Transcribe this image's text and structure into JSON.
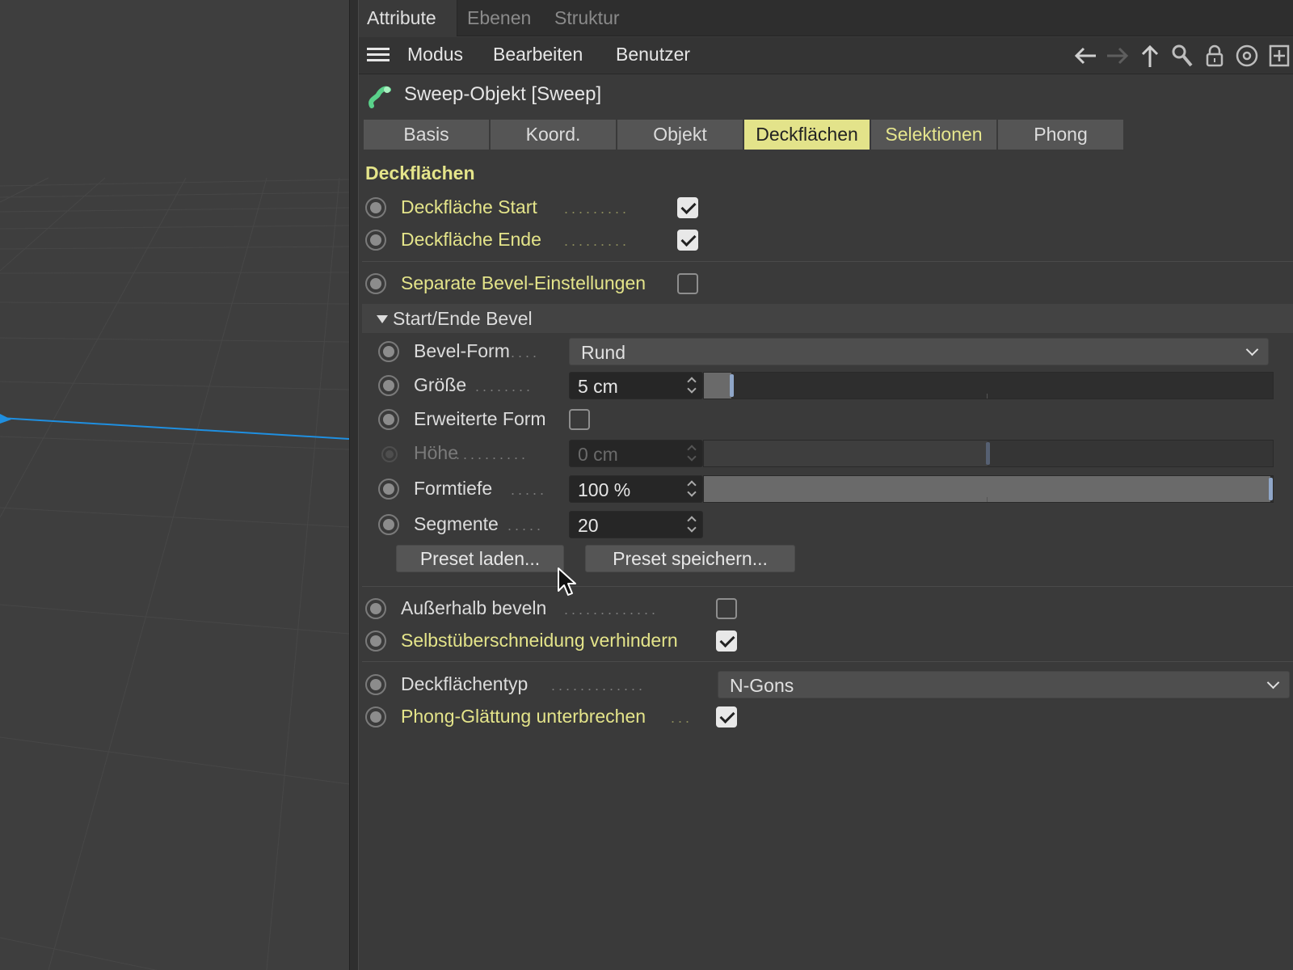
{
  "top_tabs": [
    "Attribute",
    "Ebenen",
    "Struktur"
  ],
  "menu": [
    "Modus",
    "Bearbeiten",
    "Benutzer"
  ],
  "toolbar_icons": [
    "arrow-left-icon",
    "arrow-right-icon",
    "arrow-up-icon",
    "search-icon",
    "lock-icon",
    "target-icon",
    "add-window-icon"
  ],
  "object": {
    "title": "Sweep-Objekt [Sweep]",
    "icon": "sweep-object-icon"
  },
  "sub_tabs": [
    "Basis",
    "Koord.",
    "Objekt",
    "Deckflächen",
    "Selektionen",
    "Phong"
  ],
  "active_sub_tab": "Deckflächen",
  "section_title": "Deckflächen",
  "caps": {
    "start_label": "Deckfläche Start",
    "start_checked": true,
    "end_label": "Deckfläche Ende",
    "end_checked": true,
    "separate_label": "Separate Bevel-Einstellungen",
    "separate_checked": false
  },
  "bevel_group": {
    "title": "Start/Ende Bevel",
    "form_label": "Bevel-Form",
    "form_value": "Rund",
    "size_label": "Größe",
    "size_value": "5 cm",
    "size_slider": 0.05,
    "extended_label": "Erweiterte Form",
    "extended_checked": false,
    "height_label": "Höhe",
    "height_value": "0 cm",
    "height_slider": 0.5,
    "depth_label": "Formtiefe",
    "depth_value": "100 %",
    "depth_slider": 1.0,
    "segments_label": "Segmente",
    "segments_value": "20",
    "preset_load": "Preset laden...",
    "preset_save": "Preset speichern..."
  },
  "options": {
    "outside_label": "Außerhalb beveln",
    "outside_checked": false,
    "selfint_label": "Selbstüberschneidung verhindern",
    "selfint_checked": true,
    "captype_label": "Deckflächentyp",
    "captype_value": "N-Gons",
    "phong_label": "Phong-Glättung unterbrechen",
    "phong_checked": true
  },
  "colors": {
    "accent_yellow": "#e4e48a",
    "panel_bg": "#3a3a3a",
    "handle_blue": "#8fa6c8",
    "spline_blue": "#1f8fe0"
  }
}
